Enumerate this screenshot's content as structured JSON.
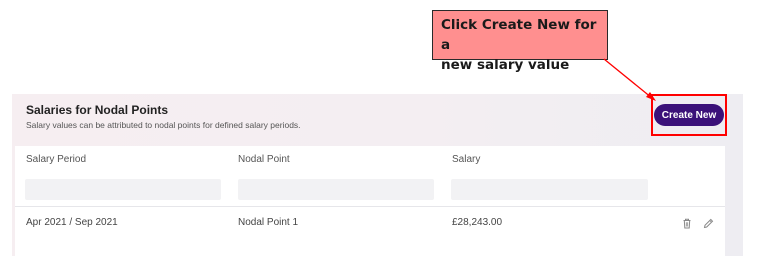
{
  "callout": {
    "line1": "Click Create New for a",
    "line2": "new salary value"
  },
  "panel": {
    "title": "Salaries for Nodal Points",
    "subtitle": "Salary values can be attributed to nodal points for defined salary periods.",
    "create_button_label": "Create New"
  },
  "table": {
    "columns": [
      "Salary Period",
      "Nodal Point",
      "Salary"
    ],
    "rows": [
      {
        "salary_period": "Apr 2021 / Sep 2021",
        "nodal_point": "Nodal Point 1",
        "salary": "£28,243.00",
        "actions": [
          "trash-icon",
          "pencil-icon"
        ]
      }
    ]
  },
  "colors": {
    "accent": "#3b1179",
    "callout_fill": "#ff8f8f",
    "highlight_border": "#ff0000"
  }
}
